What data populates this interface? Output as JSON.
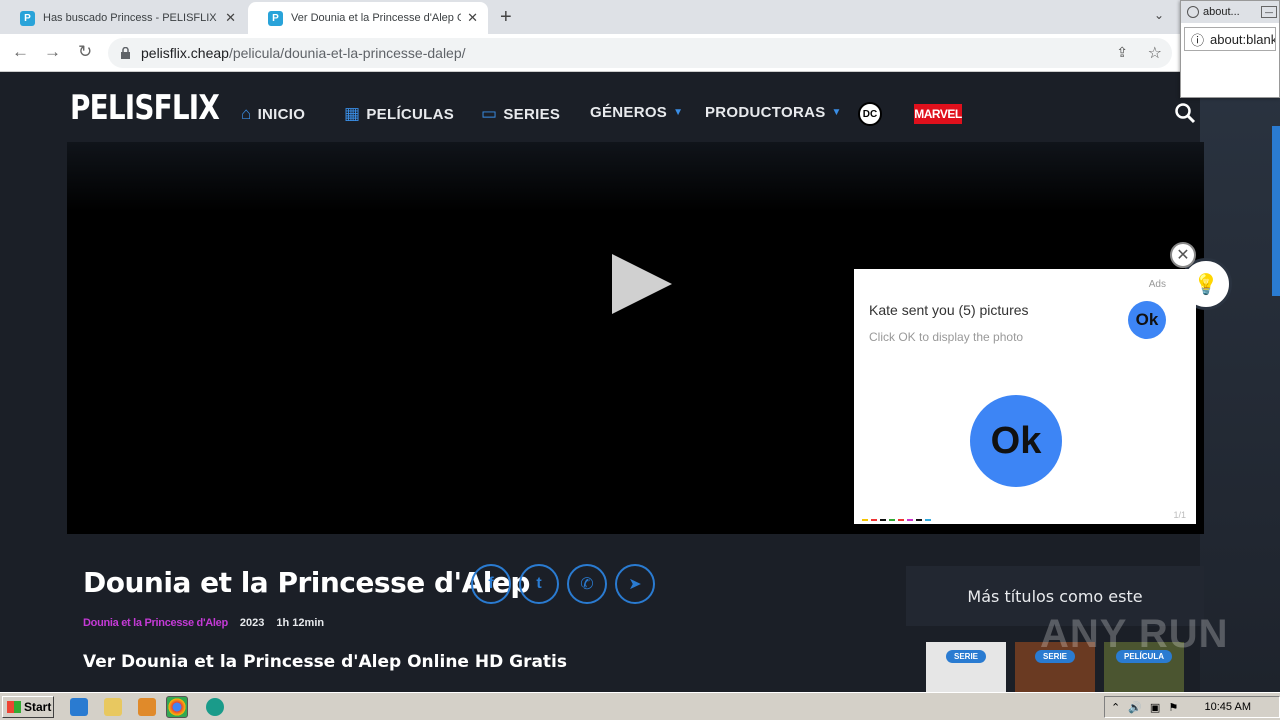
{
  "browser": {
    "tabs": [
      {
        "title": "Has buscado Princess - PELISFLIX [",
        "favicon": "P"
      },
      {
        "title": "Ver Dounia et la Princesse d'Alep Onl",
        "favicon": "P"
      }
    ],
    "url_host": "pelisflix.cheap",
    "url_path": "/pelicula/dounia-et-la-princesse-dalep/"
  },
  "popup_window": {
    "tab_title": "about...",
    "url": "about:blank"
  },
  "site": {
    "logo": "PELISFLIX",
    "nav": [
      {
        "label": "INICIO",
        "icon": "home-icon"
      },
      {
        "label": "PELÍCULAS",
        "icon": "film-icon"
      },
      {
        "label": "SERIES",
        "icon": "tv-icon"
      },
      {
        "label": "GÉNEROS",
        "icon": "caret-down-icon"
      },
      {
        "label": "PRODUCTORAS",
        "icon": "caret-down-icon"
      }
    ],
    "dc_label": "DC",
    "marvel_label": "MARVEL"
  },
  "ad": {
    "ads_label": "Ads",
    "title": "Kate sent you (5) pictures",
    "subtitle": "Click OK to display the photo",
    "ok_small": "Ok",
    "ok_big": "Ok",
    "counter": "1/1"
  },
  "movie": {
    "title": "Dounia et la Princesse d'Alep",
    "original_title": "Dounia et la Princesse d'Alep",
    "year": "2023",
    "duration": "1h 12min",
    "watch_heading": "Ver Dounia et la Princesse d'Alep Online HD Gratis"
  },
  "sidebar": {
    "heading": "Más títulos como este",
    "thumbs": [
      {
        "badge": "SERIE",
        "color": "#e6e6e6"
      },
      {
        "badge": "SERIE",
        "color": "#6a3a22"
      },
      {
        "badge": "PELÍCULA",
        "color": "#4b5530"
      }
    ]
  },
  "watermark": "ANY RUN",
  "taskbar": {
    "start_label": "Start",
    "clock": "10:45 AM"
  },
  "colors": {
    "accent": "#2a7bd1",
    "meta_pink": "#c43ad6",
    "ok_blue": "#3d85f5"
  }
}
